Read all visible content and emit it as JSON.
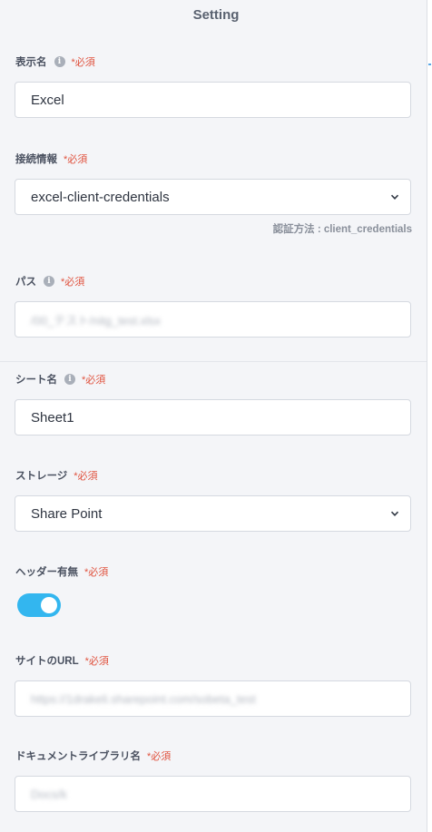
{
  "panel": {
    "title": "Setting"
  },
  "required_mark": "*必須",
  "fields": {
    "display_name": {
      "label": "表示名",
      "value": "Excel"
    },
    "connection": {
      "label": "接続情報",
      "value": "excel-client-credentials",
      "hint": "認証方法 : client_credentials"
    },
    "path": {
      "label": "パス",
      "value": "/00_テスト/nitg_test.xlsx"
    },
    "sheet_name": {
      "label": "シート名",
      "value": "Sheet1"
    },
    "storage": {
      "label": "ストレージ",
      "value": "Share Point"
    },
    "header": {
      "label": "ヘッダー有無",
      "toggle_on": true
    },
    "site_url": {
      "label": "サイトのURL",
      "value": "https://1drakeli.sharepoint.com/sobeta_test"
    },
    "doc_library": {
      "label": "ドキュメントライブラリ名",
      "value": "Docs/k"
    }
  },
  "icons": {
    "info": "info-icon",
    "dropdown": "chevron-down-icon"
  },
  "colors": {
    "accent": "#33b6ef",
    "required": "#e0533f",
    "background": "#f4f5f8"
  }
}
